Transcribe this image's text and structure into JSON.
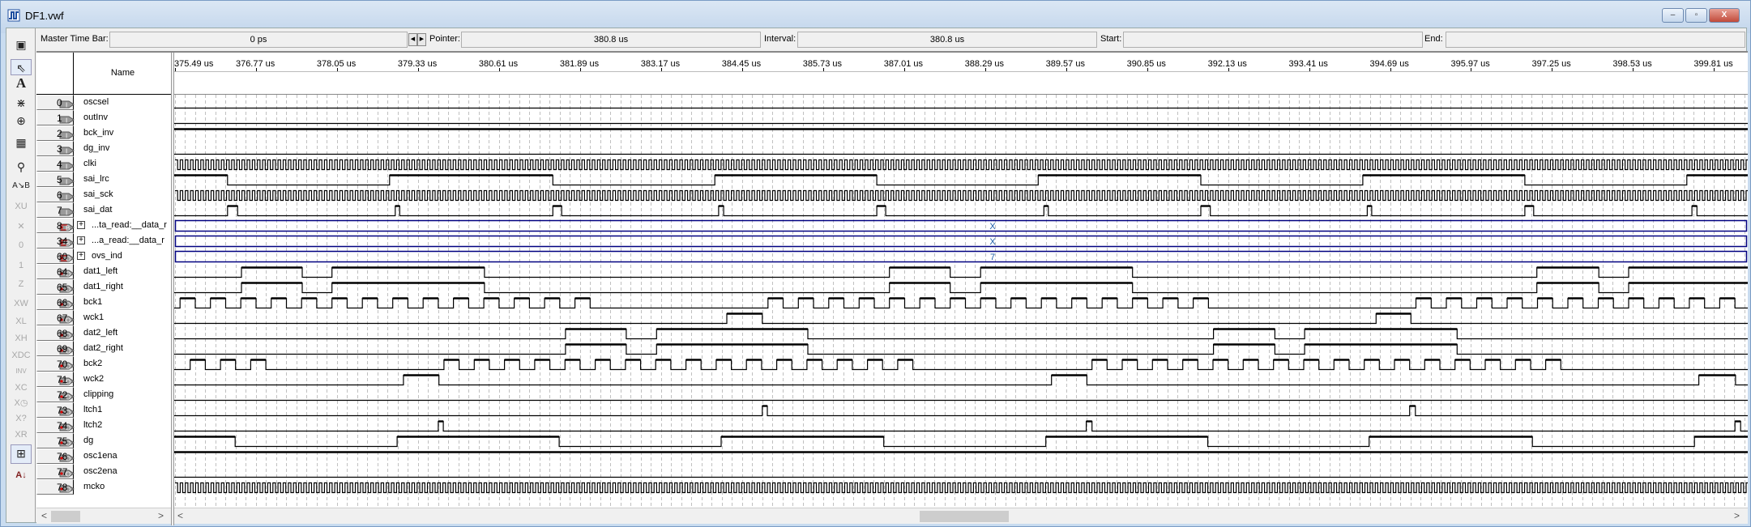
{
  "window": {
    "title": "DF1.vwf",
    "controls": {
      "minimize": "–",
      "restore": "▫",
      "close": "X"
    }
  },
  "timebar": {
    "master_label": "Master Time Bar:",
    "master_value": "0 ps",
    "pointer_label": "Pointer:",
    "pointer_value": "380.8 us",
    "interval_label": "Interval:",
    "interval_value": "380.8 us",
    "start_label": "Start:",
    "start_value": "",
    "end_label": "End:",
    "end_value": ""
  },
  "toolbar_icons": [
    "waveform-editor-icon",
    "pointer-icon",
    "text-tool-icon",
    "node-finder-icon",
    "zoom-icon",
    "full-screen-icon",
    "find-icon",
    "replace-icon",
    "uninitialized-icon",
    "forcing-unknown-icon",
    "forcing-low-icon",
    "forcing-high-icon",
    "high-impedance-icon",
    "weak-unknown-icon",
    "weak-low-icon",
    "weak-high-icon",
    "dont-care-icon",
    "invert-icon",
    "count-value-icon",
    "clock-value-icon",
    "arbitrary-value-icon",
    "random-value-icon",
    "snap-to-grid-icon",
    "sort-icon"
  ],
  "header": {
    "name_column": "Name"
  },
  "ruler": {
    "unit": "us",
    "labels": [
      "375.49 us",
      "376.77 us",
      "378.05 us",
      "379.33 us",
      "380.61 us",
      "381.89 us",
      "383.17 us",
      "384.45 us",
      "385.73 us",
      "387.01 us",
      "388.29 us",
      "389.57 us",
      "390.85 us",
      "392.13 us",
      "393.41 us",
      "394.69 us",
      "395.97 us",
      "397.25 us",
      "398.53 us",
      "399.81 us"
    ],
    "tick_values": [
      375.49,
      376.77,
      378.05,
      379.33,
      380.61,
      381.89,
      383.17,
      384.45,
      385.73,
      387.01,
      388.29,
      389.57,
      390.85,
      392.13,
      393.41,
      394.69,
      395.97,
      397.25,
      398.53,
      399.81
    ],
    "visible_time_us": [
      375.49,
      400.33
    ],
    "grid_step_us": 0.16
  },
  "signals": [
    {
      "index": "0",
      "name": "oscsel",
      "type": "input",
      "wave": {
        "kind": "level",
        "init": 0,
        "edges": []
      }
    },
    {
      "index": "1",
      "name": "outInv",
      "type": "input",
      "wave": {
        "kind": "level",
        "init": 0,
        "edges": []
      }
    },
    {
      "index": "2",
      "name": "bck_inv",
      "type": "input",
      "wave": {
        "kind": "level",
        "init": 1,
        "edges": []
      }
    },
    {
      "index": "3",
      "name": "dg_inv",
      "type": "input",
      "wave": {
        "kind": "level",
        "init": 0,
        "edges": []
      }
    },
    {
      "index": "4",
      "name": "clki",
      "type": "input",
      "wave": {
        "kind": "clock",
        "period": 0.0814
      }
    },
    {
      "index": "5",
      "name": "sai_lrc",
      "type": "input",
      "wave": {
        "kind": "level",
        "init": 1,
        "edges": [
          376.32,
          378.88,
          381.46,
          384.02,
          386.58,
          389.13,
          391.7,
          394.26,
          396.82,
          399.38
        ]
      }
    },
    {
      "index": "6",
      "name": "sai_sck",
      "type": "input",
      "wave": {
        "kind": "clock",
        "period": 0.0814
      }
    },
    {
      "index": "7",
      "name": "sai_dat",
      "type": "input",
      "wave": {
        "kind": "level",
        "init": 0,
        "edges": [
          376.32,
          376.48,
          378.97,
          379.04,
          381.46,
          381.6,
          384.08,
          384.16,
          386.58,
          386.72,
          389.22,
          389.29,
          391.7,
          391.85,
          394.33,
          394.4,
          396.82,
          396.96,
          399.46,
          399.54
        ]
      }
    },
    {
      "index": "8",
      "name": "...ta_read:__data_r",
      "type": "bus",
      "wave": {
        "kind": "bus",
        "value": "X"
      }
    },
    {
      "index": "34",
      "name": "...a_read:__data_r",
      "type": "bus",
      "wave": {
        "kind": "bus",
        "value": "X"
      }
    },
    {
      "index": "60",
      "name": "ovs_ind",
      "type": "bus-output",
      "wave": {
        "kind": "bus",
        "value": "7"
      }
    },
    {
      "index": "64",
      "name": "dat1_left",
      "type": "output",
      "wave": {
        "kind": "level",
        "init": 0,
        "edges": [
          376.54,
          377.5,
          377.97,
          380.38,
          386.78,
          387.74,
          388.22,
          390.62,
          397.01,
          397.99,
          398.46
        ]
      }
    },
    {
      "index": "65",
      "name": "dat1_right",
      "type": "output",
      "wave": {
        "kind": "level",
        "init": 0,
        "edges": [
          376.54,
          377.5,
          377.97,
          380.38,
          386.78,
          387.74,
          388.22,
          390.62,
          397.01,
          397.99,
          398.46
        ]
      }
    },
    {
      "index": "66",
      "name": "bck1",
      "type": "output",
      "wave": {
        "kind": "burst",
        "period": 0.48,
        "bursts": [
          [
            375.57,
            382.06
          ],
          [
            384.86,
            392.29
          ],
          [
            395.1,
            400.4
          ]
        ]
      }
    },
    {
      "index": "67",
      "name": "wck1",
      "type": "output",
      "wave": {
        "kind": "level",
        "init": 0,
        "edges": [
          384.21,
          384.77,
          394.47,
          395.02
        ]
      }
    },
    {
      "index": "68",
      "name": "dat2_left",
      "type": "output",
      "wave": {
        "kind": "level",
        "init": 0,
        "edges": [
          381.66,
          382.62,
          383.1,
          385.49,
          391.9,
          392.87,
          393.34,
          395.75
        ]
      }
    },
    {
      "index": "69",
      "name": "dat2_right",
      "type": "output",
      "wave": {
        "kind": "level",
        "init": 0,
        "edges": [
          381.66,
          382.62,
          383.1,
          385.49,
          391.9,
          392.87,
          393.34,
          395.75
        ]
      }
    },
    {
      "index": "70",
      "name": "bck2",
      "type": "output",
      "wave": {
        "kind": "burst",
        "period": 0.478,
        "bursts": [
          [
            375.73,
            376.92
          ],
          [
            379.74,
            387.17
          ],
          [
            389.98,
            397.42
          ],
          [
            400.23,
            400.4
          ]
        ]
      }
    },
    {
      "index": "71",
      "name": "wck2",
      "type": "output",
      "wave": {
        "kind": "level",
        "init": 0,
        "edges": [
          379.1,
          379.66,
          389.34,
          389.9,
          399.57,
          400.15
        ]
      }
    },
    {
      "index": "72",
      "name": "clipping",
      "type": "output",
      "wave": {
        "kind": "level",
        "init": 0,
        "edges": []
      }
    },
    {
      "index": "73",
      "name": "ltch1",
      "type": "output",
      "wave": {
        "kind": "level",
        "init": 0,
        "edges": [
          384.77,
          384.85,
          395.0,
          395.09
        ]
      }
    },
    {
      "index": "74",
      "name": "ltch2",
      "type": "output",
      "wave": {
        "kind": "level",
        "init": 0,
        "edges": [
          379.65,
          379.73,
          389.89,
          389.98,
          400.14,
          400.23
        ]
      }
    },
    {
      "index": "75",
      "name": "dg",
      "type": "output",
      "wave": {
        "kind": "level",
        "init": 1,
        "edges": [
          376.44,
          379.0,
          381.56,
          384.12,
          386.69,
          389.25,
          391.81,
          394.36,
          396.94,
          399.5
        ]
      }
    },
    {
      "index": "76",
      "name": "osc1ena",
      "type": "output",
      "wave": {
        "kind": "level",
        "init": 1,
        "edges": []
      }
    },
    {
      "index": "77",
      "name": "osc2ena",
      "type": "output",
      "wave": {
        "kind": "level",
        "init": 0,
        "edges": []
      }
    },
    {
      "index": "78",
      "name": "mcko",
      "type": "output",
      "wave": {
        "kind": "clock",
        "period": 0.0814
      }
    }
  ],
  "scrollbars": {
    "left_arrow": "<",
    "right_arrow": ">"
  },
  "colors": {
    "bus": "#000080",
    "wave": "#000000",
    "grid": "#c0c0c0",
    "bus_value": "#1f5fa8"
  }
}
